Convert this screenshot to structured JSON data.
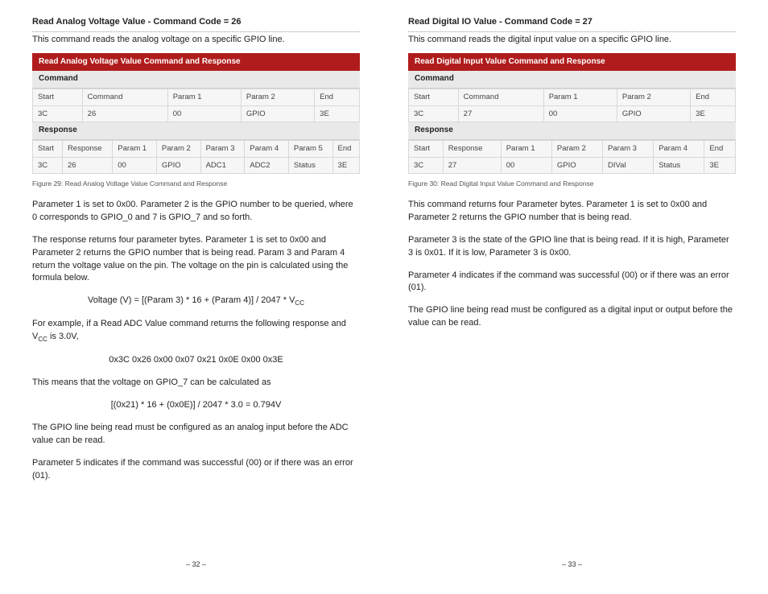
{
  "left": {
    "title": "Read Analog Voltage Value - Command Code = 26",
    "intro": "This command reads the analog voltage on a specific GPIO line.",
    "tbl_title": "Read Analog Voltage Value Command and Response",
    "cmd_label": "Command",
    "cmd_h": [
      "Start",
      "Command",
      "Param 1",
      "Param 2",
      "End"
    ],
    "cmd_r": [
      "3C",
      "26",
      "00",
      "GPIO",
      "3E"
    ],
    "resp_label": "Response",
    "resp_h": [
      "Start",
      "Response",
      "Param 1",
      "Param 2",
      "Param 3",
      "Param 4",
      "Param 5",
      "End"
    ],
    "resp_r": [
      "3C",
      "26",
      "00",
      "GPIO",
      "ADC1",
      "ADC2",
      "Status",
      "3E"
    ],
    "caption": "Figure 29: Read Analog Voltage Value Command and Response",
    "p1": "Parameter 1 is set to 0x00. Parameter 2 is the GPIO number to be queried, where 0 corresponds to GPIO_0 and 7 is GPIO_7 and so forth.",
    "p2": "The response returns four parameter bytes. Parameter 1 is set to 0x00 and Parameter 2 returns the GPIO number that is being read. Param 3 and Param 4 return the voltage value on the pin. The voltage on the pin is calculated using the formula below.",
    "formula1a": "Voltage (V) = [(Param 3) * 16 + (Param 4)] / 2047 * V",
    "formula1b": "CC",
    "p3a": "For example, if a Read ADC Value command returns the following response and V",
    "p3b": "CC",
    "p3c": " is 3.0V,",
    "hex": "0x3C 0x26 0x00 0x07 0x21 0x0E 0x00 0x3E",
    "p4": "This means that the voltage on GPIO_7 can be calculated as",
    "formula2": "[(0x21) * 16 + (0x0E)] / 2047 * 3.0 = 0.794V",
    "p5": "The GPIO line being read must be configured as an analog input before the ADC value can be read.",
    "p6": "Parameter 5 indicates if the command was successful (00) or if there was an error (01).",
    "pagenum": "– 32 –"
  },
  "right": {
    "title": "Read Digital IO Value - Command Code = 27",
    "intro": "This command reads the digital input value on a specific GPIO line.",
    "tbl_title": "Read Digital Input Value Command and Response",
    "cmd_label": "Command",
    "cmd_h": [
      "Start",
      "Command",
      "Param 1",
      "Param 2",
      "End"
    ],
    "cmd_r": [
      "3C",
      "27",
      "00",
      "GPIO",
      "3E"
    ],
    "resp_label": "Response",
    "resp_h": [
      "Start",
      "Response",
      "Param 1",
      "Param 2",
      "Param 3",
      "Param 4",
      "End"
    ],
    "resp_r": [
      "3C",
      "27",
      "00",
      "GPIO",
      "DIVal",
      "Status",
      "3E"
    ],
    "caption": "Figure 30: Read Digital Input Value Command and Response",
    "p1": "This command returns four Parameter bytes. Parameter 1 is set to 0x00 and Parameter 2 returns the GPIO number that is being read.",
    "p2": "Parameter 3 is the state of the GPIO line that is being read. If it is high, Parameter 3 is 0x01. If it is low, Parameter 3 is 0x00.",
    "p3": "Parameter 4 indicates if the command was successful (00) or if there was an error (01).",
    "p4": "The GPIO line being read must be configured as a digital input or output before the value can be read.",
    "pagenum": "– 33 –"
  }
}
